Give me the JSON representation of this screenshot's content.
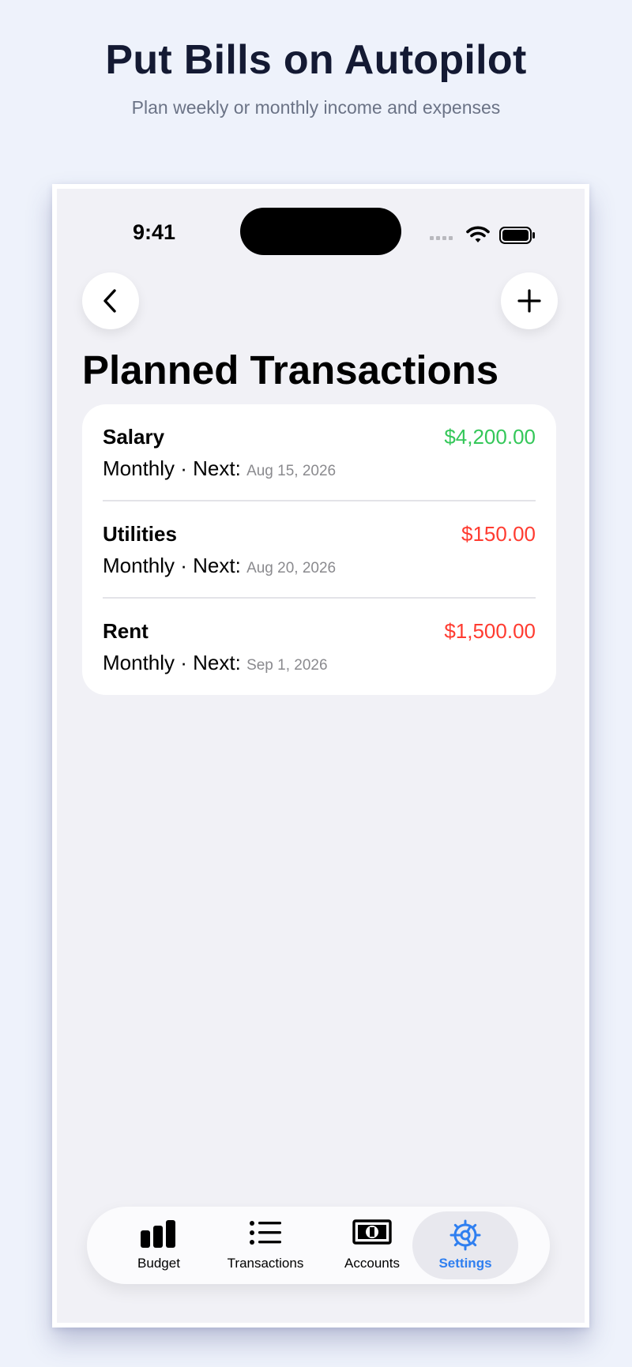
{
  "header": {
    "headline": "Put Bills on Autopilot",
    "subheadline": "Plan weekly or monthly income and expenses"
  },
  "status_bar": {
    "time": "9:41"
  },
  "nav": {
    "back_icon": "chevron-left-icon",
    "add_icon": "plus-icon"
  },
  "page": {
    "title": "Planned Transactions"
  },
  "transactions": [
    {
      "name": "Salary",
      "amount": "$4,200.00",
      "kind": "income",
      "schedule": "Monthly · Next: ",
      "next_date": "Aug 15, 2026"
    },
    {
      "name": "Utilities",
      "amount": "$150.00",
      "kind": "expense",
      "schedule": "Monthly · Next: ",
      "next_date": "Aug 20, 2026"
    },
    {
      "name": "Rent",
      "amount": "$1,500.00",
      "kind": "expense",
      "schedule": "Monthly · Next: ",
      "next_date": "Sep 1, 2026"
    }
  ],
  "tabbar": {
    "tabs": [
      {
        "label": "Budget",
        "icon": "bar-chart-icon",
        "active": false
      },
      {
        "label": "Transactions",
        "icon": "list-icon",
        "active": false
      },
      {
        "label": "Accounts",
        "icon": "banknote-icon",
        "active": false
      },
      {
        "label": "Settings",
        "icon": "gear-icon",
        "active": true
      }
    ]
  },
  "colors": {
    "income": "#34c759",
    "expense": "#ff3b30",
    "accent": "#2f7ff0",
    "background": "#eef2fb"
  }
}
